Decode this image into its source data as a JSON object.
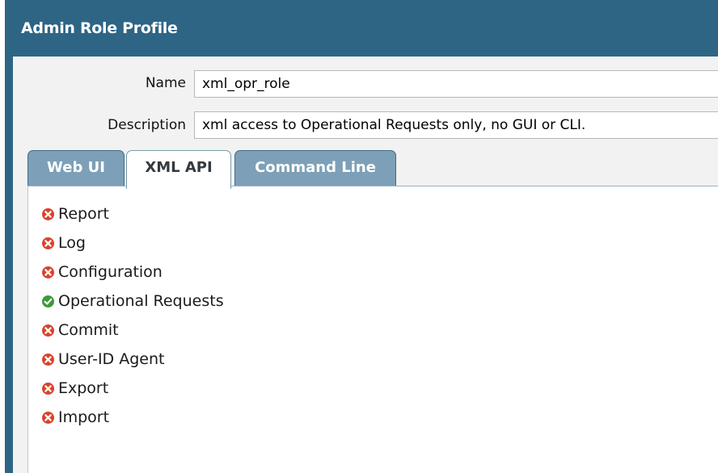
{
  "window": {
    "title": "Admin Role Profile"
  },
  "form": {
    "name_label": "Name",
    "name_value": "xml_opr_role",
    "description_label": "Description",
    "description_value": "xml access to Operational Requests only, no GUI or CLI."
  },
  "tabs": [
    {
      "label": "Web UI",
      "active": false
    },
    {
      "label": "XML API",
      "active": true
    },
    {
      "label": "Command Line",
      "active": false
    }
  ],
  "permissions": [
    {
      "label": "Report",
      "status": "disabled"
    },
    {
      "label": "Log",
      "status": "disabled"
    },
    {
      "label": "Configuration",
      "status": "disabled"
    },
    {
      "label": "Operational Requests",
      "status": "enabled"
    },
    {
      "label": "Commit",
      "status": "disabled"
    },
    {
      "label": "User-ID Agent",
      "status": "disabled"
    },
    {
      "label": "Export",
      "status": "disabled"
    },
    {
      "label": "Import",
      "status": "disabled"
    }
  ],
  "colors": {
    "title_bar": "#2e6585",
    "tab_inactive": "#7da0b8",
    "disabled_icon": "#d9432b",
    "enabled_icon": "#3a9a3a"
  }
}
